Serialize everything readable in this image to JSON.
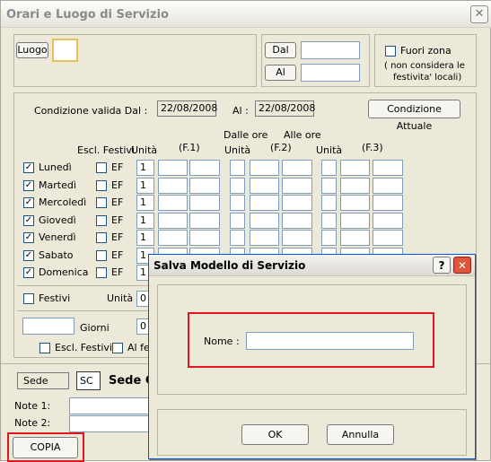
{
  "window": {
    "title": "Orari e Luogo di Servizio",
    "close": "✕"
  },
  "luogo": {
    "label": "Luogo",
    "value": ""
  },
  "dal": {
    "label": "Dal",
    "value": ""
  },
  "al": {
    "label": "Al",
    "value": ""
  },
  "fuori_zona": {
    "label": "Fuori zona",
    "note1": "( non considera le",
    "note2": "festivita' locali)",
    "checked": false
  },
  "condizione": {
    "label": "Condizione valida Dal :",
    "dal_value": "22/08/2008",
    "al_label": "Al :",
    "al_value": "22/08/2008",
    "button": "Condizione Attuale"
  },
  "headers": {
    "escl": "Escl. Festivi",
    "unita1": "Unità",
    "f1": "(F.1)",
    "dalle_ore": "Dalle ore",
    "alle_ore": "Alle ore",
    "unita2": "Unità",
    "f2": "(F.2)",
    "unita3": "Unità",
    "f3": "(F.3)"
  },
  "days": [
    {
      "name": "Lunedì",
      "checked": true,
      "ef": "EF",
      "unita": "1"
    },
    {
      "name": "Martedì",
      "checked": true,
      "ef": "EF",
      "unita": "1"
    },
    {
      "name": "Mercoledì",
      "checked": true,
      "ef": "EF",
      "unita": "1"
    },
    {
      "name": "Giovedì",
      "checked": true,
      "ef": "EF",
      "unita": "1"
    },
    {
      "name": "Venerdì",
      "checked": true,
      "ef": "EF",
      "unita": "1"
    },
    {
      "name": "Sabato",
      "checked": true,
      "ef": "EF",
      "unita": "1"
    },
    {
      "name": "Domenica",
      "checked": true,
      "ef": "EF",
      "unita": "1"
    }
  ],
  "festivi": {
    "label": "Festivi",
    "unita_label": "Unità",
    "unita_value": "0"
  },
  "giorni": {
    "label": "Giorni",
    "value": "0",
    "escl_label": "Escl. Festivi",
    "al_fe_label": "Al fe"
  },
  "sede": {
    "label": "Sede",
    "code": "SC",
    "name": "Sede C"
  },
  "note1": {
    "label": "Note 1:"
  },
  "note2": {
    "label": "Note 2:"
  },
  "copia_button": "COPIA",
  "dialog": {
    "title": "Salva Modello di Servizio",
    "help": "?",
    "close": "✕",
    "nome_label": "Nome :",
    "nome_value": "",
    "ok": "OK",
    "annulla": "Annulla"
  }
}
